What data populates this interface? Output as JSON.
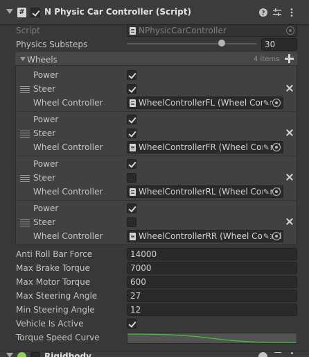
{
  "header": {
    "title": "N Physic Car Controller (Script)",
    "icons": [
      "script-icon",
      "help-icon",
      "presets-icon",
      "more-icon"
    ],
    "enabled": true
  },
  "script": {
    "label": "Script",
    "value": "NPhysicCarController"
  },
  "physics_substeps": {
    "label": "Physics Substeps",
    "value": "30",
    "slider_fraction": 0.73
  },
  "wheels": {
    "label": "Wheels",
    "count_text": "4 items",
    "items": [
      {
        "power_label": "Power",
        "power": true,
        "steer_label": "Steer",
        "steer": true,
        "controller_label": "Wheel Controller",
        "controller": "WheelControllerFL (Wheel Control"
      },
      {
        "power_label": "Power",
        "power": true,
        "steer_label": "Steer",
        "steer": true,
        "controller_label": "Wheel Controller",
        "controller": "WheelControllerFR (Wheel Control"
      },
      {
        "power_label": "Power",
        "power": true,
        "steer_label": "Steer",
        "steer": false,
        "controller_label": "Wheel Controller",
        "controller": "WheelControllerRL (Wheel Control"
      },
      {
        "power_label": "Power",
        "power": true,
        "steer_label": "Steer",
        "steer": false,
        "controller_label": "Wheel Controller",
        "controller": "WheelControllerRR (Wheel Control"
      }
    ]
  },
  "fields": [
    {
      "label": "Anti Roll Bar Force",
      "value": "14000"
    },
    {
      "label": "Max Brake Torque",
      "value": "7000"
    },
    {
      "label": "Max Motor Torque",
      "value": "600"
    },
    {
      "label": "Max Steering Angle",
      "value": "27"
    },
    {
      "label": "Min Steering Angle",
      "value": "12"
    }
  ],
  "vehicle_is_active": {
    "label": "Vehicle Is Active",
    "value": true
  },
  "torque_speed_curve": {
    "label": "Torque Speed Curve",
    "curve_color": "#3bc43b"
  },
  "colors": {
    "background": "#383838",
    "field": "#2a2a2a",
    "list_box": "#414141",
    "text": "#c4c4c4"
  },
  "next_component": {
    "label": "Rigidbody"
  }
}
